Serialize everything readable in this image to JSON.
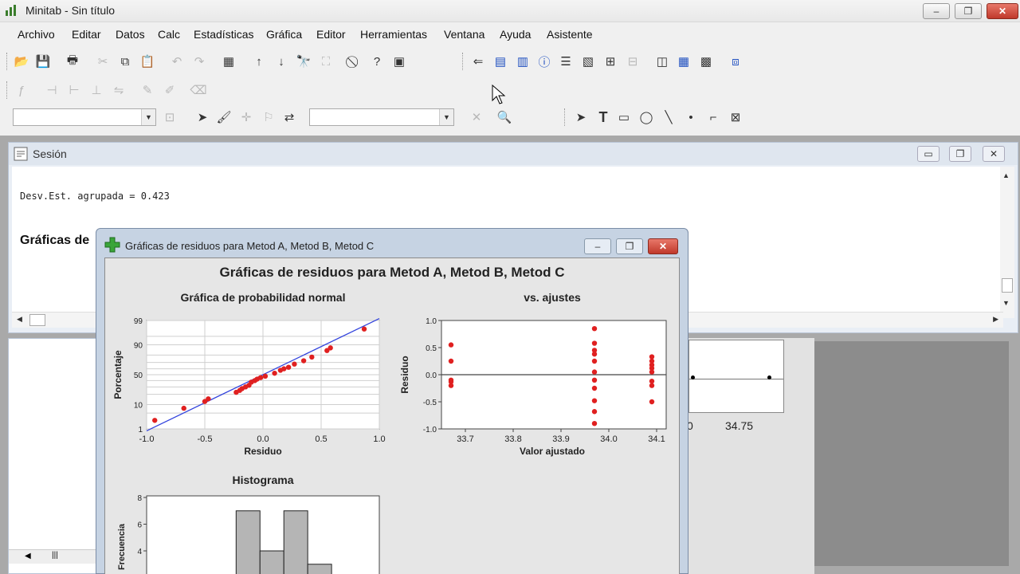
{
  "window": {
    "title": "Minitab - Sin título"
  },
  "menu": [
    "Archivo",
    "Editar",
    "Datos",
    "Calc",
    "Estadísticas",
    "Gráfica",
    "Editor",
    "Herramientas",
    "Ventana",
    "Ayuda",
    "Asistente"
  ],
  "session": {
    "title": "Sesión",
    "output_line": "Desv.Est. agrupada = 0.423",
    "heading_partial": "Gráficas de"
  },
  "background_graph": {
    "tick_partial": "0",
    "tick_label": "34.75"
  },
  "resid_window": {
    "title": "Gráficas de residuos para Metod A, Metod B, Metod C",
    "main_title": "Gráficas de residuos para Metod A, Metod B, Metod C",
    "prob": {
      "title": "Gráfica de probabilidad normal",
      "xlabel": "Residuo",
      "ylabel": "Porcentaje",
      "xticks": [
        "-1.0",
        "-0.5",
        "0.0",
        "0.5",
        "1.0"
      ],
      "yticks": [
        "1",
        "10",
        "50",
        "90",
        "99"
      ]
    },
    "fits": {
      "title": "vs. ajustes",
      "xlabel": "Valor ajustado",
      "ylabel": "Residuo",
      "xticks": [
        "33.7",
        "33.8",
        "33.9",
        "34.0",
        "34.1"
      ],
      "yticks": [
        "1.0",
        "0.5",
        "0.0",
        "-0.5",
        "-1.0"
      ]
    },
    "hist": {
      "title": "Histograma",
      "ylabel": "Frecuencia",
      "yticks": [
        "8",
        "6",
        "4"
      ]
    }
  },
  "chart_data": [
    {
      "type": "scatter",
      "title": "Gráfica de probabilidad normal",
      "xlabel": "Residuo",
      "ylabel": "Porcentaje",
      "xlim": [
        -1.0,
        1.0
      ],
      "y_scale": "normal-probability",
      "yticks": [
        1,
        10,
        50,
        90,
        99
      ],
      "points": [
        [
          -0.93,
          2.5
        ],
        [
          -0.68,
          7.5
        ],
        [
          -0.5,
          12.5
        ],
        [
          -0.47,
          15
        ],
        [
          -0.23,
          22.5
        ],
        [
          -0.2,
          25
        ],
        [
          -0.18,
          27.5
        ],
        [
          -0.15,
          30
        ],
        [
          -0.12,
          32.5
        ],
        [
          -0.1,
          37.5
        ],
        [
          -0.07,
          40
        ],
        [
          -0.05,
          42.5
        ],
        [
          -0.02,
          45
        ],
        [
          0.02,
          47.5
        ],
        [
          0.1,
          52.5
        ],
        [
          0.15,
          57.5
        ],
        [
          0.18,
          60
        ],
        [
          0.22,
          62.5
        ],
        [
          0.27,
          67.5
        ],
        [
          0.35,
          72.5
        ],
        [
          0.42,
          77.5
        ],
        [
          0.55,
          85
        ],
        [
          0.58,
          87.5
        ],
        [
          0.87,
          97.5
        ]
      ],
      "fit_line": [
        [
          -1.0,
          0.8
        ],
        [
          1.0,
          99.2
        ]
      ]
    },
    {
      "type": "scatter",
      "title": "vs. ajustes",
      "xlabel": "Valor ajustado",
      "ylabel": "Residuo",
      "xlim": [
        33.65,
        34.12
      ],
      "ylim": [
        -1.0,
        1.0
      ],
      "reference_line": 0,
      "points": [
        [
          33.67,
          0.55
        ],
        [
          33.67,
          0.25
        ],
        [
          33.67,
          -0.1
        ],
        [
          33.67,
          -0.13
        ],
        [
          33.67,
          -0.2
        ],
        [
          33.97,
          0.85
        ],
        [
          33.97,
          0.58
        ],
        [
          33.97,
          0.45
        ],
        [
          33.97,
          0.38
        ],
        [
          33.97,
          0.25
        ],
        [
          33.97,
          0.05
        ],
        [
          33.97,
          -0.1
        ],
        [
          33.97,
          -0.25
        ],
        [
          33.97,
          -0.48
        ],
        [
          33.97,
          -0.68
        ],
        [
          33.97,
          -0.9
        ],
        [
          34.09,
          0.33
        ],
        [
          34.09,
          0.25
        ],
        [
          34.09,
          0.18
        ],
        [
          34.09,
          0.12
        ],
        [
          34.09,
          0.05
        ],
        [
          34.09,
          -0.12
        ],
        [
          34.09,
          -0.2
        ],
        [
          34.09,
          -0.5
        ]
      ]
    },
    {
      "type": "bar",
      "title": "Histograma",
      "ylabel": "Frecuencia",
      "ylim": [
        2.8,
        8
      ],
      "bins": [
        {
          "from": -0.2,
          "to": 0.0,
          "count": 7
        },
        {
          "from": 0.0,
          "to": 0.2,
          "count": 4
        },
        {
          "from": 0.2,
          "to": 0.4,
          "count": 7
        },
        {
          "from": 0.4,
          "to": 0.6,
          "count": 3
        }
      ]
    }
  ]
}
